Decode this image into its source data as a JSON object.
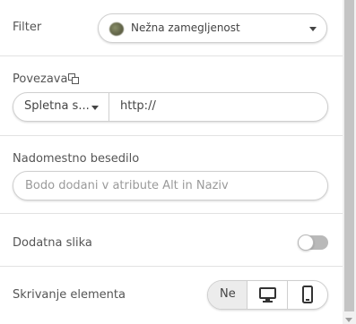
{
  "filter": {
    "label": "Filter",
    "selected": "Nežna zamegljenost",
    "thumb_icon": "blurred-image-thumbnail"
  },
  "link": {
    "label": "Povezava",
    "icon": "copy-icon",
    "type_selected": "Spletna s...",
    "url_value": "http://"
  },
  "alt_text": {
    "label": "Nadomestno besedilo",
    "placeholder": "Bodo dodani v atribute Alt in Naziv"
  },
  "extra_image": {
    "label": "Dodatna slika",
    "enabled": false
  },
  "hide_element": {
    "label": "Skrivanje elementa",
    "options": [
      {
        "label": "Ne",
        "selected": true
      },
      {
        "icon": "desktop-icon",
        "selected": false
      },
      {
        "icon": "mobile-icon",
        "selected": false
      }
    ]
  },
  "colors": {
    "border": "#cfcfcf",
    "divider": "#e2e2e2",
    "selected_segment": "#ececec",
    "toggle_off": "#b9b9b9"
  }
}
